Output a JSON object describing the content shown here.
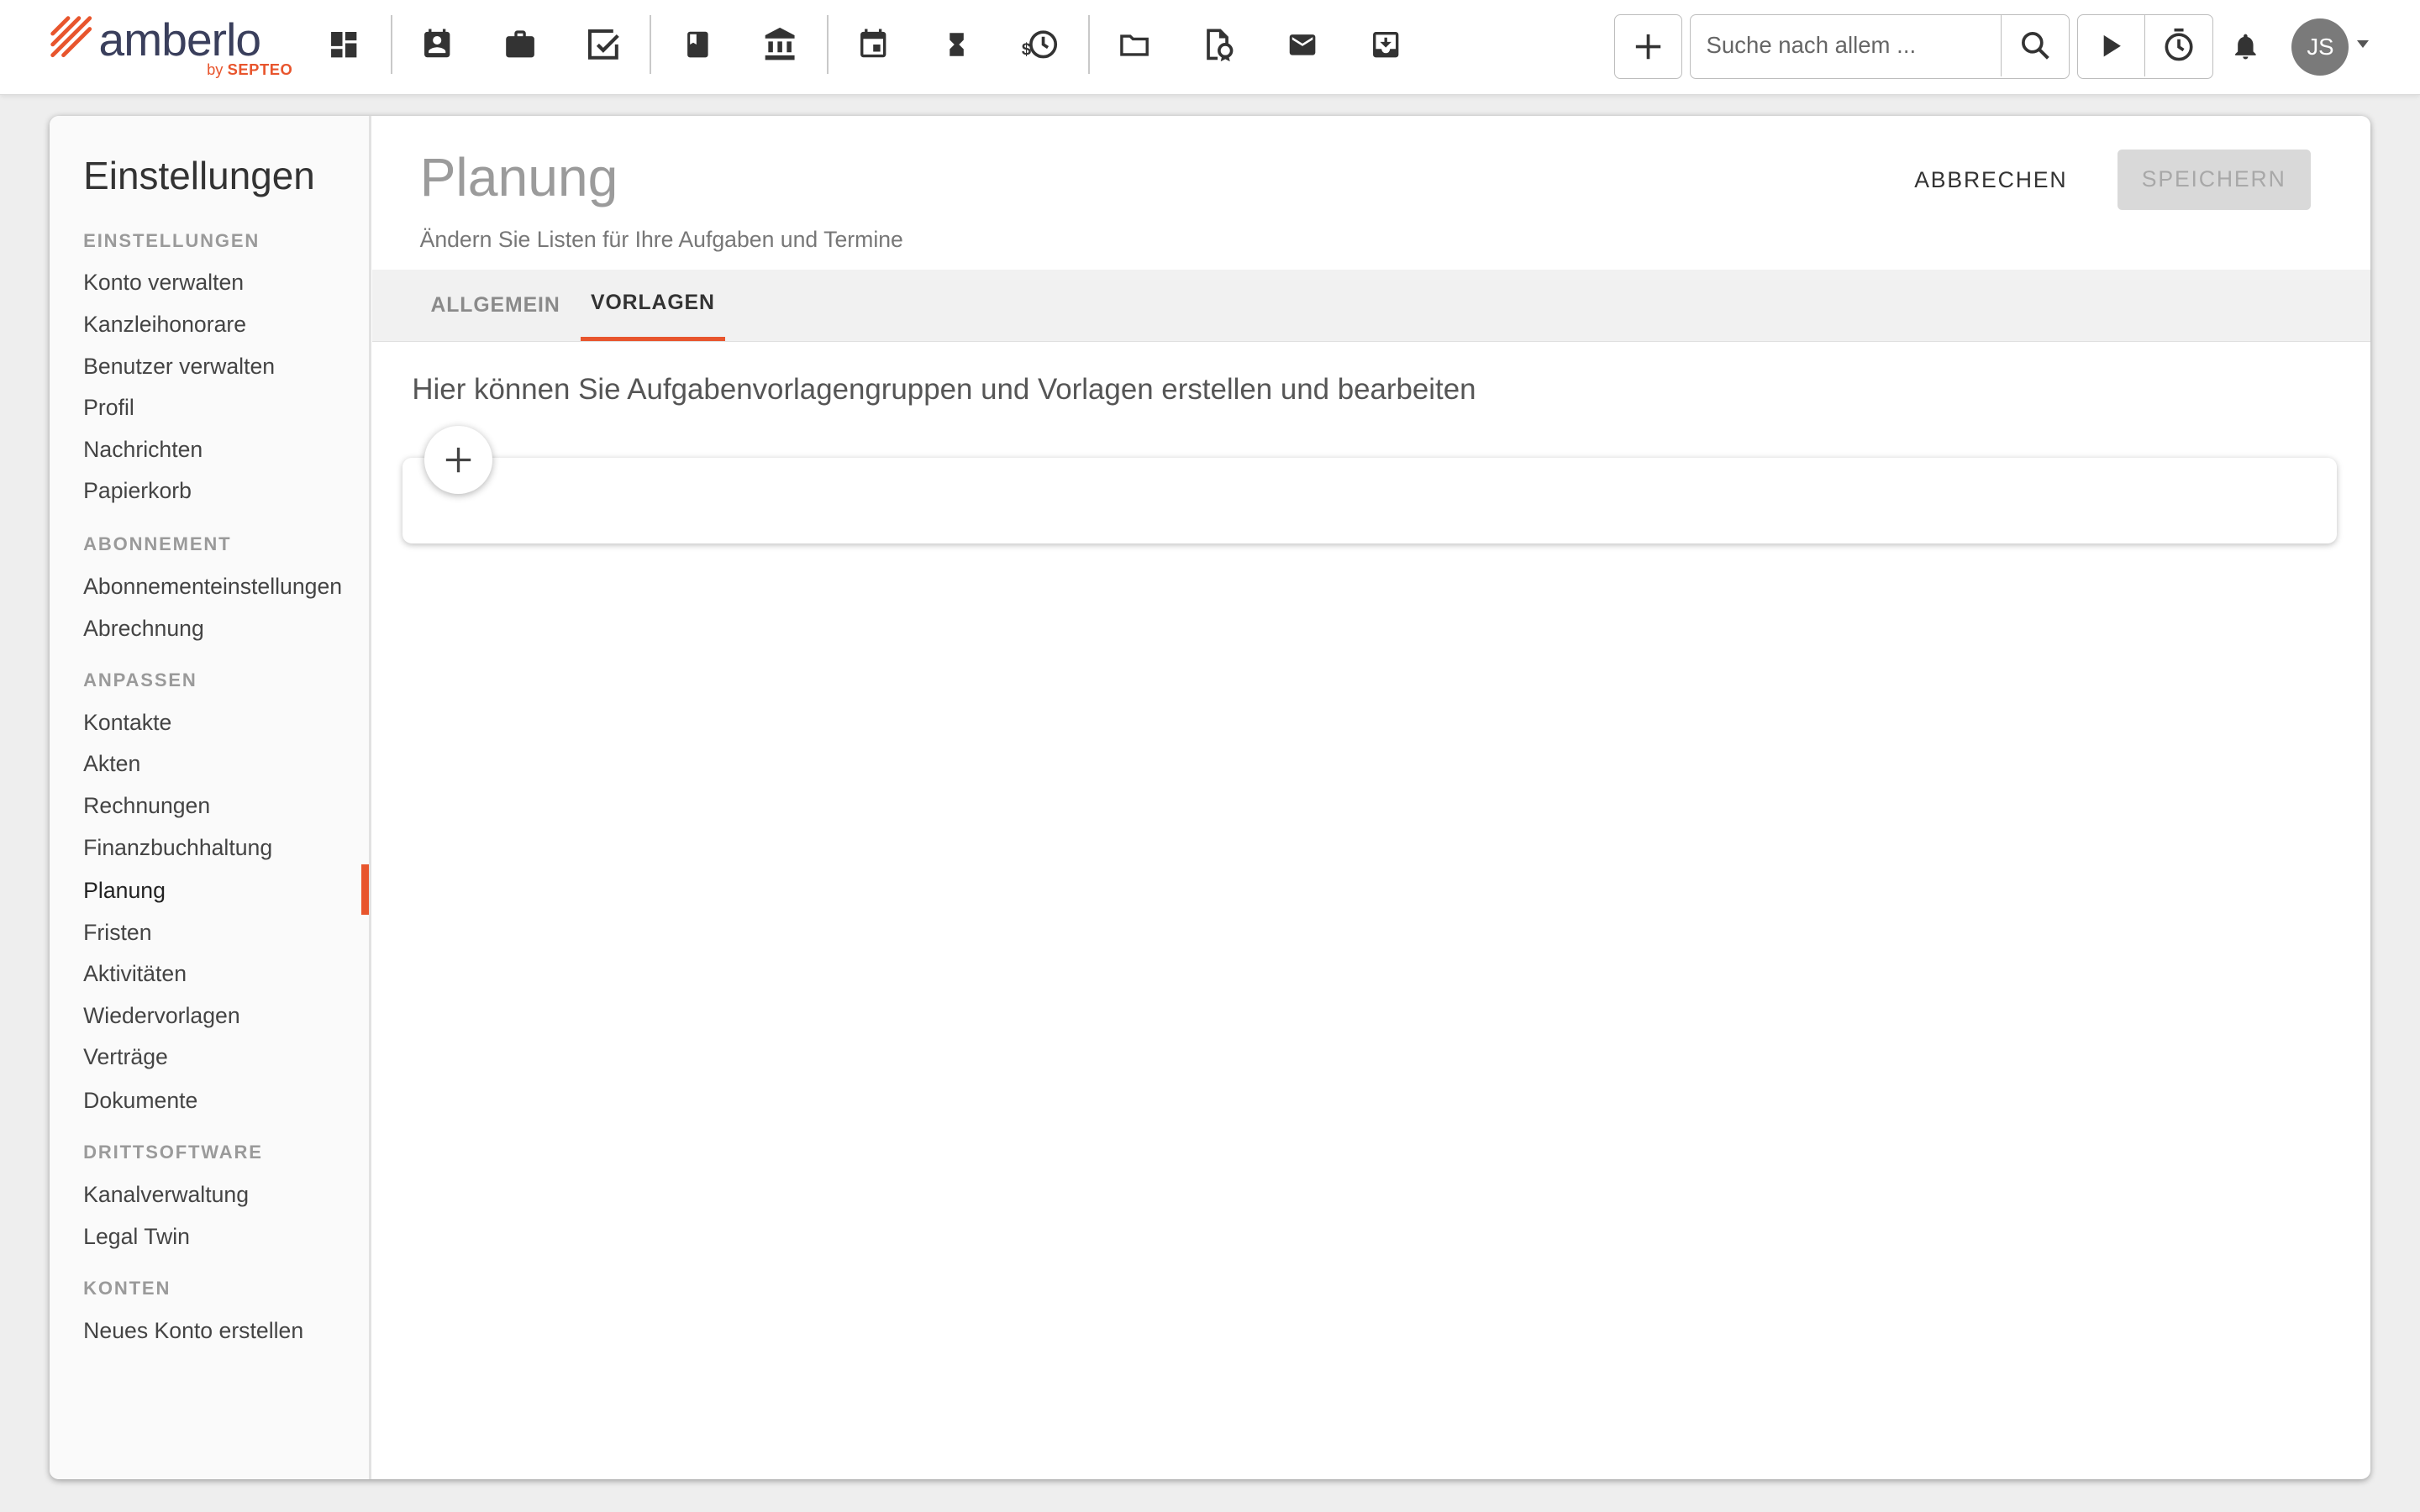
{
  "app": {
    "logo_text": "amberlo",
    "logo_sub_by": "by",
    "logo_sub_brand": "SEPTEO",
    "brand_color": "#e8552d"
  },
  "topnav": {
    "icons": [
      "dashboard-icon",
      "contacts-icon",
      "matters-briefcase-icon",
      "tasks-check-icon",
      "book-icon",
      "bank-icon",
      "calendar-icon",
      "hourglass-icon",
      "time-money-icon",
      "folder-icon",
      "document-certificate-icon",
      "mail-icon",
      "inbox-download-icon"
    ],
    "search_placeholder": "Suche nach allem ...",
    "user_initials": "JS"
  },
  "sidebar": {
    "title": "Einstellungen",
    "sections": [
      {
        "label": "EINSTELLUNGEN",
        "items": [
          "Konto verwalten",
          "Kanzleihonorare",
          "Benutzer verwalten",
          "Profil",
          "Nachrichten",
          "Papierkorb"
        ]
      },
      {
        "label": "ABONNEMENT",
        "items": [
          "Abonnementeinstellungen",
          "Abrechnung"
        ]
      },
      {
        "label": "ANPASSEN",
        "items": [
          "Kontakte",
          "Akten",
          "Rechnungen",
          "Finanzbuchhaltung",
          "Planung",
          "Fristen",
          "Aktivitäten",
          "Wiedervorlagen",
          "Verträge",
          "Dokumente"
        ]
      },
      {
        "label": "DRITTSOFTWARE",
        "items": [
          "Kanalverwaltung",
          "Legal Twin"
        ]
      },
      {
        "label": "KONTEN",
        "items": [
          "Neues Konto erstellen"
        ]
      }
    ],
    "active_item": "Planung"
  },
  "main": {
    "title": "Planung",
    "subtitle": "Ändern Sie Listen für Ihre Aufgaben und Termine",
    "cancel_label": "ABBRECHEN",
    "save_label": "SPEICHERN",
    "tabs": [
      "ALLGEMEIN",
      "VORLAGEN"
    ],
    "active_tab": "VORLAGEN",
    "intro": "Hier können Sie Aufgabenvorlagengruppen und Vorlagen erstellen und bearbeiten"
  }
}
